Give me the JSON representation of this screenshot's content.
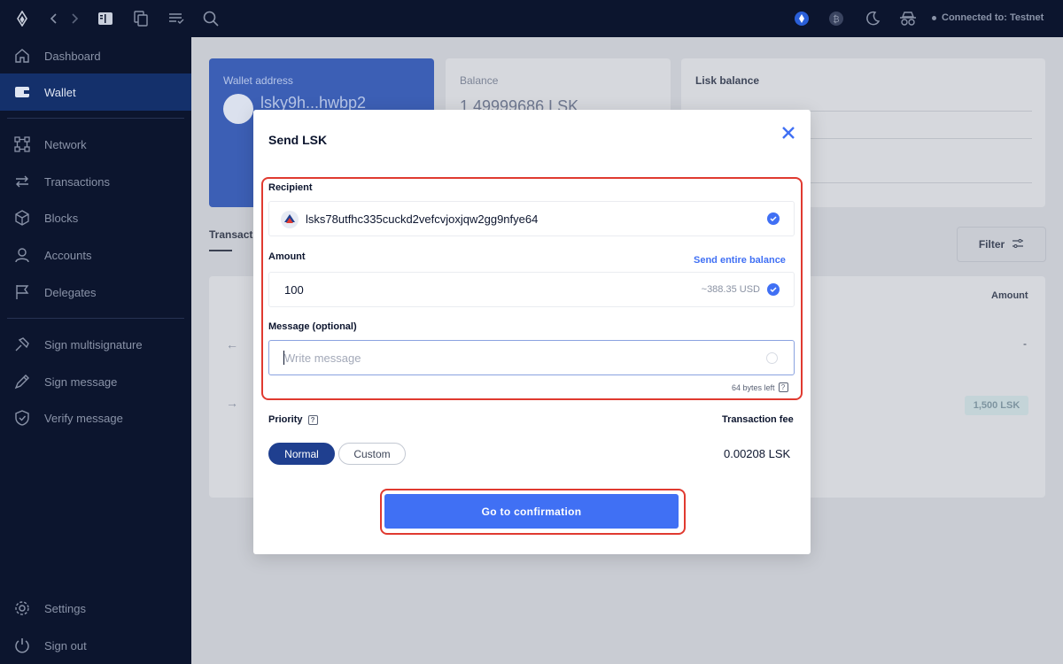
{
  "topbar": {
    "connection_status": "Connected to: Testnet",
    "icons": [
      "lisk-logo-icon",
      "back-icon",
      "forward-icon",
      "bookmark-icon",
      "copy-icon",
      "list-icon",
      "search-icon",
      "lisk-token-icon",
      "bitcoin-icon",
      "dark-mode-icon",
      "incognito-icon"
    ]
  },
  "sidebar": {
    "items": [
      {
        "label": "Dashboard",
        "icon": "home-icon"
      },
      {
        "label": "Wallet",
        "icon": "wallet-icon",
        "active": true
      },
      {
        "label": "Network",
        "icon": "network-icon"
      },
      {
        "label": "Transactions",
        "icon": "transactions-icon"
      },
      {
        "label": "Blocks",
        "icon": "blocks-icon"
      },
      {
        "label": "Accounts",
        "icon": "accounts-icon"
      },
      {
        "label": "Delegates",
        "icon": "flag-icon"
      },
      {
        "label": "Sign multisignature",
        "icon": "multisig-icon"
      },
      {
        "label": "Sign message",
        "icon": "pen-icon"
      },
      {
        "label": "Verify message",
        "icon": "shield-icon"
      }
    ],
    "bottom": [
      {
        "label": "Settings",
        "icon": "gear-icon"
      },
      {
        "label": "Sign out",
        "icon": "power-icon"
      }
    ]
  },
  "background": {
    "wallet_address_label": "Wallet address",
    "wallet_address": "lsky9h...hwbp2",
    "balance_label": "Balance",
    "balance_value": "1.49999686 LSK",
    "lisk_balance_title": "Lisk balance",
    "tab_label": "Transact",
    "filter_label": "Filter",
    "amount_header": "Amount",
    "dash_value": "-",
    "pill_value": "1,500 LSK"
  },
  "modal": {
    "title": "Send LSK",
    "recipient_label": "Recipient",
    "recipient_value": "lsks78utfhc335cuckd2vefcvjoxjqw2gg9nfye64",
    "amount_label": "Amount",
    "send_entire_balance": "Send entire balance",
    "amount_value": "100",
    "amount_usd": "~388.35 USD",
    "message_label": "Message (optional)",
    "message_placeholder": "Write message",
    "bytes_left": "64 bytes left",
    "priority_label": "Priority",
    "transaction_fee_label": "Transaction fee",
    "priority_options": [
      "Normal",
      "Custom"
    ],
    "selected_priority": "Normal",
    "fee_value": "0.00208 LSK",
    "confirm_button": "Go to confirmation"
  },
  "colors": {
    "sidebar_bg": "#0c152e",
    "active_item_bg": "#14306b",
    "accent": "#4070f4",
    "highlight": "#e03a30"
  }
}
